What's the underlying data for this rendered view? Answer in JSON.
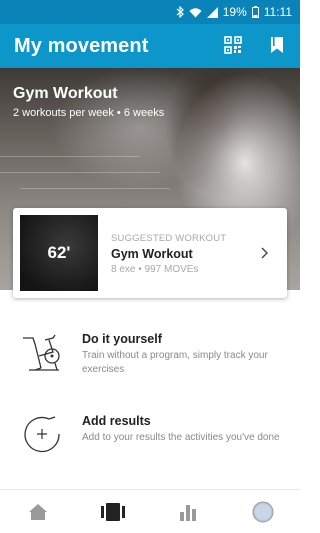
{
  "status_bar": {
    "battery": "19%",
    "time": "11:11"
  },
  "app_bar": {
    "title": "My movement",
    "icons": [
      "qr-code-icon",
      "bookmark-icon"
    ]
  },
  "hero": {
    "title": "Gym Workout",
    "subtitle": "2 workouts per week • 6 weeks"
  },
  "suggested": {
    "duration": "62'",
    "label": "SUGGESTED WORKOUT",
    "title": "Gym Workout",
    "meta": "8 exe • 997 MOVEs"
  },
  "options": [
    {
      "title": "Do it yourself",
      "description": "Train without a program, simply track your exercises",
      "icon": "exercise-bike-icon"
    },
    {
      "title": "Add results",
      "description": "Add to your results the activities you've done",
      "icon": "add-circle-icon"
    }
  ],
  "bottom_nav": [
    "home-icon",
    "workouts-icon",
    "stats-icon",
    "profile-icon"
  ],
  "colors": {
    "primary": "#0d96c9",
    "status_bar": "#0a83b8",
    "nav_active": "#222222",
    "nav_inactive": "#9a9a9a"
  }
}
